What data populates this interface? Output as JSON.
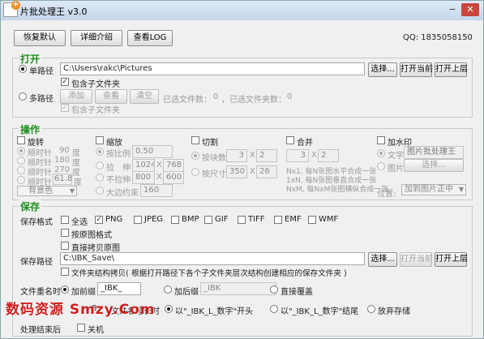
{
  "window": {
    "title": "片批处理王 v3.0",
    "minimize": "−",
    "close": "✕"
  },
  "toolbar": {
    "restore_default": "恢复默认",
    "details": "详细介绍",
    "view_log": "查看LOG",
    "qq": "QQ: 1835058150"
  },
  "open": {
    "title": "打开",
    "single_path_label": "单路径",
    "single_path_value": "C:\\Users\\rakc\\Pictures",
    "browse": "选择...",
    "open_current": "打开当前",
    "open_parent": "打开上层",
    "include_sub": "包含子文件夹",
    "multi_path_label": "多路径",
    "add": "添加",
    "view": "查看",
    "clear": "清空",
    "selected_files": "已选文件数：",
    "selected_files_count": "0",
    "selected_folders": "，已选文件夹数：",
    "selected_folders_count": "0",
    "include_sub2": "包含子文件夹"
  },
  "ops": {
    "title": "操作",
    "rotate": "旋转",
    "cw90": "顺时针",
    "cw90_val": "90",
    "cw180": "顺时针",
    "cw180_val": "180",
    "cw270": "顺时针",
    "cw270_val": "270",
    "cwx": "顺时针",
    "cwx_val": "61.8",
    "degree": "度",
    "bgcolor": "背景色",
    "scale": "缩放",
    "by_ratio": "按比例",
    "ratio_val": "0.50",
    "stretch": "拉　伸",
    "stretch_w": "1024",
    "stretch_h": "768",
    "no_stretch": "不拉伸",
    "nostretch_w": "800",
    "nostretch_h": "600",
    "long_side": "大边约束",
    "long_side_val": "160",
    "x_sep": "X",
    "cut": "切割",
    "by_blocks": "按块数",
    "blocks_w": "3",
    "blocks_h": "2",
    "by_size": "按尺寸",
    "size_w": "350",
    "size_h": "26",
    "merge": "合并",
    "merge_w": "3",
    "merge_h": "2",
    "merge_note1": "Nx1, 每N张图水平合成一张",
    "merge_note2": "1xN, 每N张图垂直合成一张",
    "merge_note3": "NxM, 每NxM张图横纵合成一张",
    "watermark": "加水印",
    "wm_text": "文字",
    "wm_text_val": "图片批处理王",
    "wm_image": "图片",
    "wm_choose": "选择...",
    "position": "位置:",
    "position_val": "加到图片正中"
  },
  "save": {
    "title": "保存",
    "format_label": "保存格式",
    "all": "全选",
    "png": "PNG",
    "jpeg": "JPEG",
    "bmp": "BMP",
    "gif": "GIF",
    "tiff": "TIFF",
    "emf": "EMF",
    "wmf": "WMF",
    "by_orig_format": "按原图格式",
    "direct_copy": "直接拷贝原图",
    "path_label": "保存路径",
    "path_value": "C:\\IBK_Save\\",
    "browse": "选择...",
    "open_current": "打开当前",
    "open_parent": "打开上层",
    "copy_struct": "文件夹结构拷贝( 根据打开路径下各个子文件夹层次结构创建相应的保存文件夹 )",
    "rename_label": "文件重名时",
    "prefix": "加前缀",
    "prefix_val": "_IBK_",
    "suffix": "加后缀",
    "suffix_val": "_IBK",
    "overwrite": "直接覆盖",
    "name_too_long": "文件名超长时",
    "name_start_digits": "8",
    "opt_prefix_num": "以\"_IBK_L_数字\"开头",
    "opt_suffix_num": "以\"_IBK_L_数字\"结尾",
    "abandon": "放弃存储",
    "after_label": "处理结束后",
    "after_val": "关机"
  },
  "watermark_overlay": "数码资源 Smzy.Com"
}
